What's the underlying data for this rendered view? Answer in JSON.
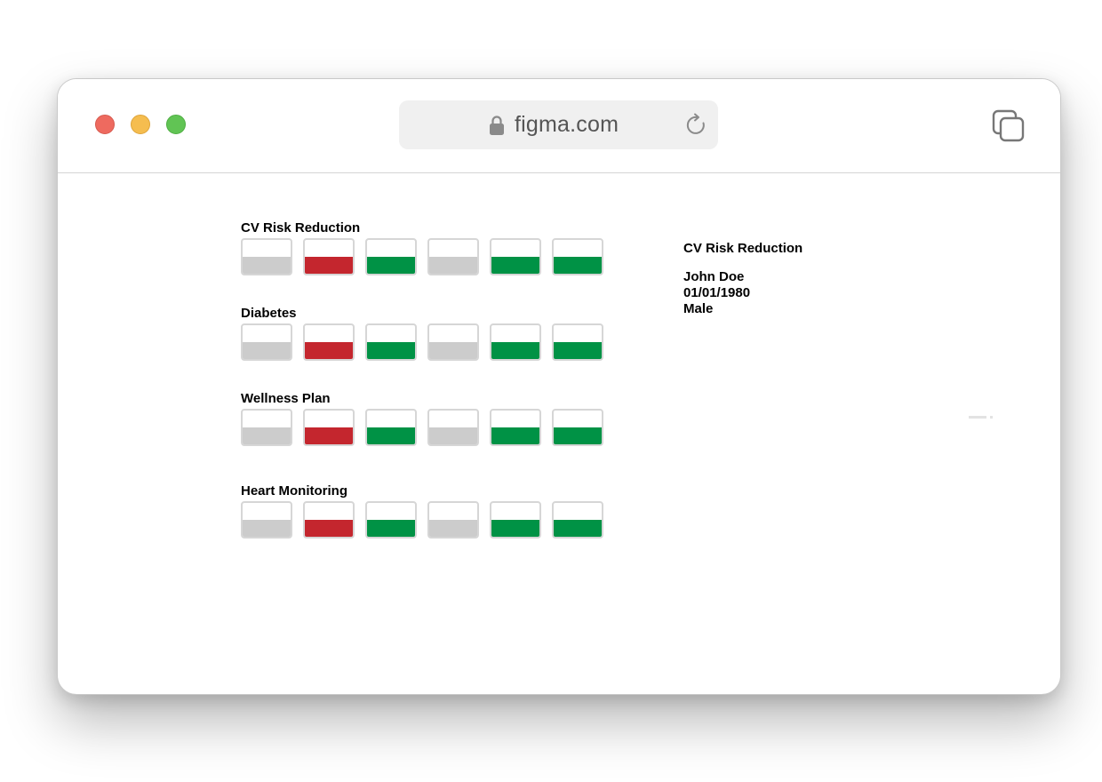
{
  "browser": {
    "url": "figma.com",
    "icons": {
      "lock": "lock-icon",
      "reload": "reload-icon",
      "tabs": "tabs-overview-icon"
    }
  },
  "colors": {
    "gray": "#cccccc",
    "red": "#c4262e",
    "green": "#009245"
  },
  "programs": [
    {
      "name": "CV Risk Reduction",
      "tiles": [
        {
          "status": "gray",
          "level": 0.5
        },
        {
          "status": "red",
          "level": 0.5
        },
        {
          "status": "green",
          "level": 0.5
        },
        {
          "status": "gray",
          "level": 0.5
        },
        {
          "status": "green",
          "level": 0.5
        },
        {
          "status": "green",
          "level": 0.5
        }
      ]
    },
    {
      "name": "Diabetes",
      "tiles": [
        {
          "status": "gray",
          "level": 0.5
        },
        {
          "status": "red",
          "level": 0.5
        },
        {
          "status": "green",
          "level": 0.5
        },
        {
          "status": "gray",
          "level": 0.5
        },
        {
          "status": "green",
          "level": 0.5
        },
        {
          "status": "green",
          "level": 0.5
        }
      ]
    },
    {
      "name": "Wellness Plan",
      "tiles": [
        {
          "status": "gray",
          "level": 0.5
        },
        {
          "status": "red",
          "level": 0.5
        },
        {
          "status": "green",
          "level": 0.5
        },
        {
          "status": "gray",
          "level": 0.5
        },
        {
          "status": "green",
          "level": 0.5
        },
        {
          "status": "green",
          "level": 0.5
        }
      ]
    },
    {
      "name": "Heart Monitoring",
      "tiles": [
        {
          "status": "gray",
          "level": 0.5
        },
        {
          "status": "red",
          "level": 0.5
        },
        {
          "status": "green",
          "level": 0.5
        },
        {
          "status": "gray",
          "level": 0.5
        },
        {
          "status": "green",
          "level": 0.5
        },
        {
          "status": "green",
          "level": 0.5
        }
      ]
    }
  ],
  "patient": {
    "program": "CV Risk Reduction",
    "name": "John Doe",
    "dob": "01/01/1980",
    "sex": "Male"
  }
}
